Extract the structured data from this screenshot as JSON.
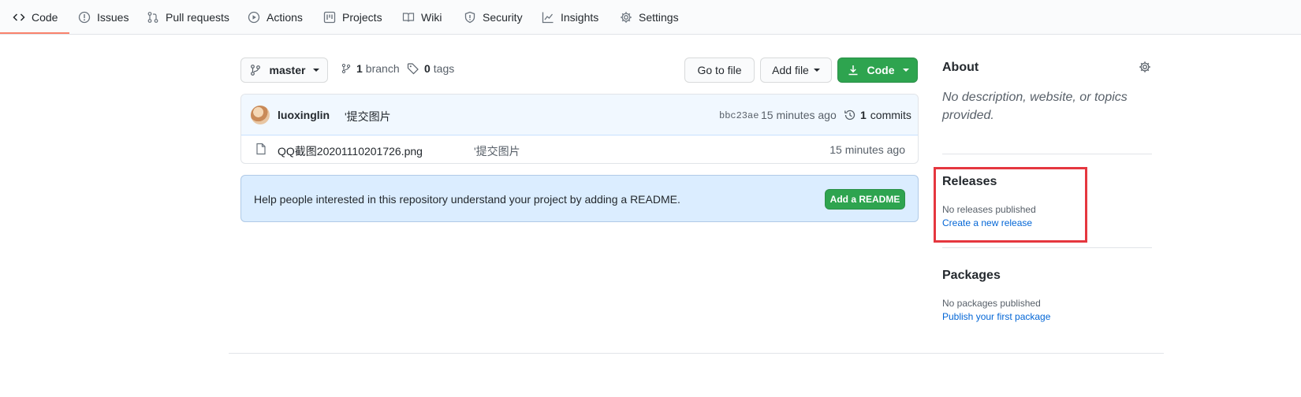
{
  "nav": {
    "tabs": [
      {
        "label": "Code",
        "icon": "code-icon"
      },
      {
        "label": "Issues",
        "icon": "issue-icon"
      },
      {
        "label": "Pull requests",
        "icon": "pull-request-icon"
      },
      {
        "label": "Actions",
        "icon": "play-icon"
      },
      {
        "label": "Projects",
        "icon": "project-icon"
      },
      {
        "label": "Wiki",
        "icon": "book-icon"
      },
      {
        "label": "Security",
        "icon": "shield-icon"
      },
      {
        "label": "Insights",
        "icon": "graph-icon"
      },
      {
        "label": "Settings",
        "icon": "gear-icon"
      }
    ],
    "active_tab": "Code",
    "active_color": "#f9826c"
  },
  "toolbar": {
    "branch": "master",
    "branch_count": "1",
    "branch_label": "branch",
    "tag_count": "0",
    "tag_label": "tags",
    "go_to_file": "Go to file",
    "add_file": "Add file",
    "code": "Code"
  },
  "commit": {
    "author": "luoxinglin",
    "message": "'提交图片",
    "sha": "bbc23ae",
    "time": "15 minutes ago",
    "commit_count": "1",
    "commits_label": "commits"
  },
  "files": [
    {
      "name": "QQ截图20201110201726.png",
      "message": "'提交图片",
      "time": "15 minutes ago"
    }
  ],
  "readme": {
    "text": "Help people interested in this repository understand your project by adding a README.",
    "button": "Add a README"
  },
  "sidebar": {
    "about_title": "About",
    "about_desc": "No description, website, or topics provided.",
    "releases_title": "Releases",
    "releases_text": "No releases published",
    "releases_link": "Create a new release",
    "packages_title": "Packages",
    "packages_text": "No packages published",
    "packages_link": "Publish your first package"
  },
  "colors": {
    "green": "#2ea44f",
    "link": "#0366d6",
    "highlight": "#e5373f"
  }
}
